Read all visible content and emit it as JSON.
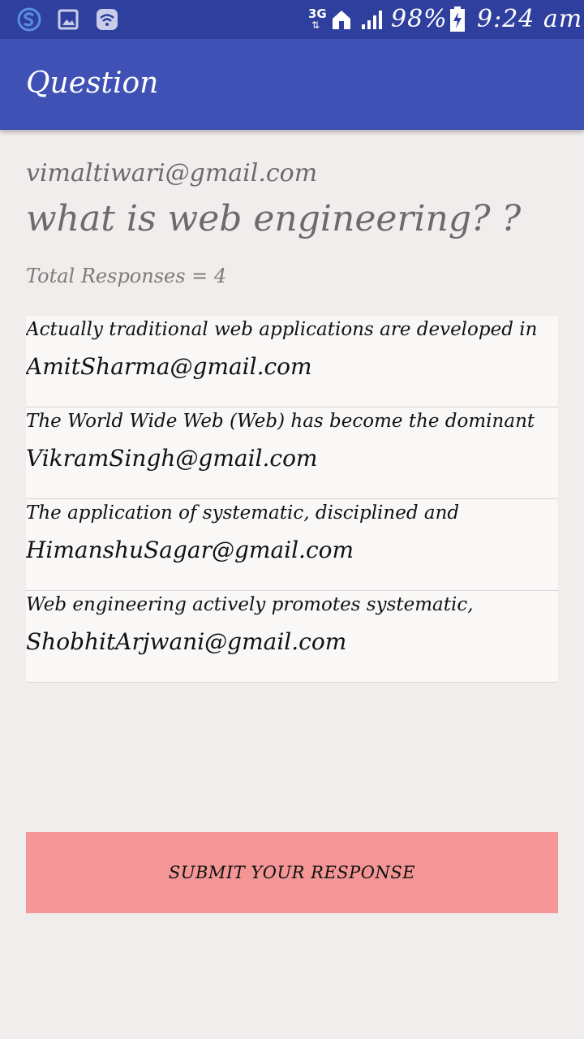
{
  "status_bar": {
    "network": "3G",
    "battery": "98%",
    "time": "9:24 am"
  },
  "app_bar": {
    "title": "Question"
  },
  "question": {
    "owner_email": "vimaltiwari@gmail.com",
    "text": "what is web engineering? ?",
    "total_responses": "Total Responses = 4"
  },
  "responses": [
    {
      "text": "Actually traditional web applications are developed in",
      "email": "AmitSharma@gmail.com"
    },
    {
      "text": "The World Wide Web (Web) has become the dominant",
      "email": "VikramSingh@gmail.com"
    },
    {
      "text": "The application of systematic, disciplined and",
      "email": "HimanshuSagar@gmail.com"
    },
    {
      "text": "Web engineering actively promotes systematic,",
      "email": "ShobhitArjwani@gmail.com"
    }
  ],
  "submit": {
    "label": "SUBMIT YOUR RESPONSE"
  },
  "colors": {
    "status_bar": "#2f3f9e",
    "app_bar": "#3f51b5",
    "background": "#f2eded",
    "submit_button": "#f49696"
  }
}
